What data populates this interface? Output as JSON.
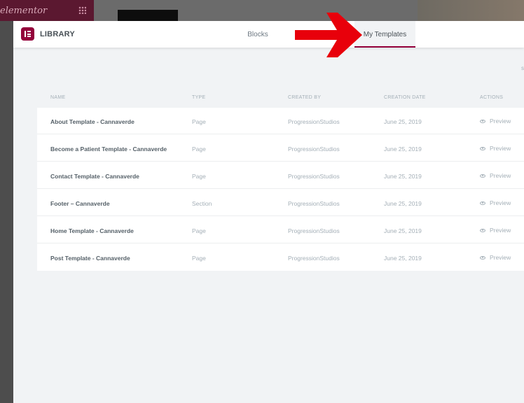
{
  "background": {
    "brand_text": "elementor"
  },
  "modal": {
    "title": "LIBRARY",
    "tabs": [
      {
        "label": "Blocks",
        "active": false
      },
      {
        "label": "My Templates",
        "active": true
      }
    ],
    "accent_color": "#93003a",
    "edge_mark": "s"
  },
  "table": {
    "columns": [
      "NAME",
      "TYPE",
      "CREATED BY",
      "CREATION DATE",
      "ACTIONS"
    ],
    "rows": [
      {
        "name": "About Template - Cannaverde",
        "type": "Page",
        "created_by": "ProgressionStudios",
        "date": "June 25, 2019",
        "action": "Preview"
      },
      {
        "name": "Become a Patient Template - Cannaverde",
        "type": "Page",
        "created_by": "ProgressionStudios",
        "date": "June 25, 2019",
        "action": "Preview"
      },
      {
        "name": "Contact Template - Cannaverde",
        "type": "Page",
        "created_by": "ProgressionStudios",
        "date": "June 25, 2019",
        "action": "Preview"
      },
      {
        "name": "Footer – Cannaverde",
        "type": "Section",
        "created_by": "ProgressionStudios",
        "date": "June 25, 2019",
        "action": "Preview"
      },
      {
        "name": "Home Template - Cannaverde",
        "type": "Page",
        "created_by": "ProgressionStudios",
        "date": "June 25, 2019",
        "action": "Preview"
      },
      {
        "name": "Post Template - Cannaverde",
        "type": "Page",
        "created_by": "ProgressionStudios",
        "date": "June 25, 2019",
        "action": "Preview"
      }
    ]
  },
  "annotation": {
    "arrow_color": "#e8000b",
    "icon": "red-arrow-right"
  }
}
